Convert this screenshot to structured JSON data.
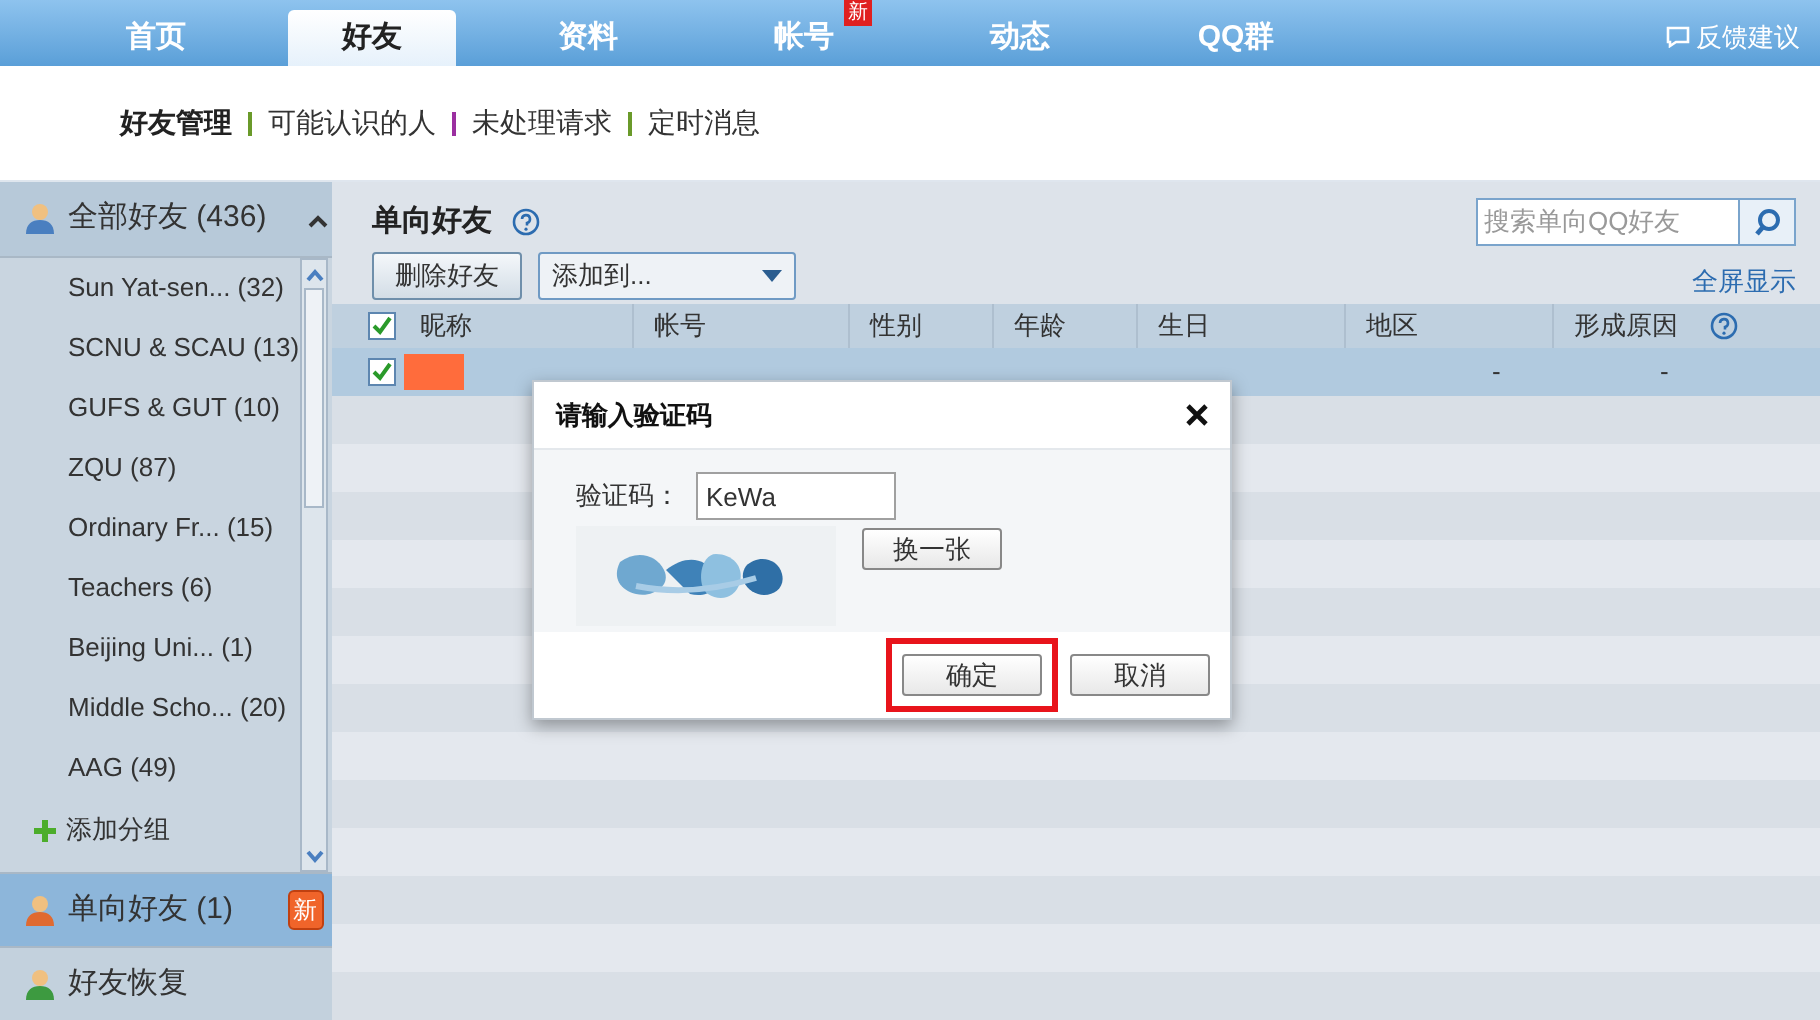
{
  "nav": {
    "tabs": [
      {
        "label": "首页",
        "selected": false
      },
      {
        "label": "好友",
        "selected": true
      },
      {
        "label": "资料",
        "selected": false
      },
      {
        "label": "帐号",
        "selected": false,
        "badge": "新"
      },
      {
        "label": "动态",
        "selected": false
      },
      {
        "label": "QQ群",
        "selected": false
      }
    ],
    "feedback": "反馈建议"
  },
  "subnav": [
    {
      "label": "好友管理",
      "selected": true
    },
    {
      "label": "可能认识的人",
      "selected": false
    },
    {
      "label": "未处理请求",
      "selected": false
    },
    {
      "label": "定时消息",
      "selected": false
    }
  ],
  "sidebar": {
    "all_friends": {
      "label": "全部好友 (436)",
      "expanded": true
    },
    "groups": [
      "Sun Yat-sen... (32)",
      "SCNU & SCAU (13)",
      "GUFS & GUT (10)",
      "ZQU (87)",
      "Ordinary Fr... (15)",
      "Teachers (6)",
      "Beijing Uni... (1)",
      "Middle Scho... (20)",
      "AAG (49)"
    ],
    "add_group": "添加分组",
    "sections": [
      {
        "label": "单向好友 (1)",
        "selected": true,
        "badge": "新"
      },
      {
        "label": "好友恢复",
        "selected": false
      }
    ]
  },
  "main": {
    "title": "单向好友",
    "delete_button": "删除好友",
    "add_to": "添加到...",
    "search": {
      "placeholder": "搜索单向QQ好友"
    },
    "fullscreen": "全屏显示",
    "header_checked": true,
    "columns": [
      "昵称",
      "帐号",
      "性别",
      "年龄",
      "生日",
      "地区",
      "形成原因"
    ],
    "rows": [
      {
        "checked": true,
        "selected": true,
        "region": "-",
        "reason": "-"
      }
    ]
  },
  "dialog": {
    "title": "请输入验证码",
    "label": "验证码：",
    "value": "KeWa",
    "refresh": "换一张",
    "ok": "确定",
    "cancel": "取消",
    "ok_highlighted": true
  }
}
